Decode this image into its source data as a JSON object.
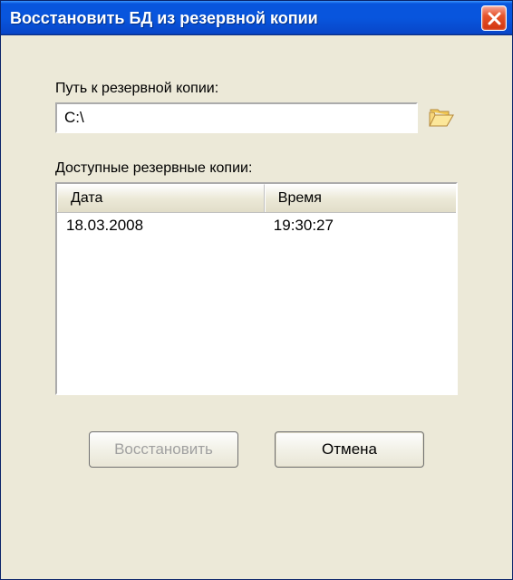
{
  "window": {
    "title": "Восстановить БД из резервной копии"
  },
  "path": {
    "label": "Путь к резервной копии:",
    "value": "C:\\"
  },
  "backups": {
    "label": "Доступные резервные копии:",
    "columns": {
      "date": "Дата",
      "time": "Время"
    },
    "rows": [
      {
        "date": "18.03.2008",
        "time": "19:30:27"
      }
    ]
  },
  "buttons": {
    "restore": "Восстановить",
    "cancel": "Отмена"
  }
}
